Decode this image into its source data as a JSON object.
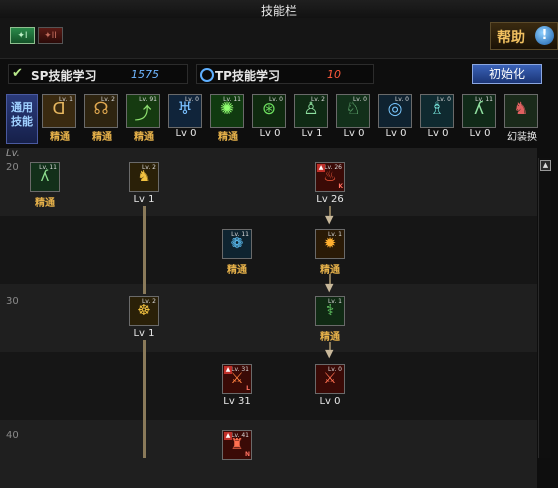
{
  "window": {
    "title": "技能栏"
  },
  "tabs": [
    {
      "label": "✦I",
      "active": true
    },
    {
      "label": "✦II",
      "active": false
    }
  ],
  "help": {
    "label": "帮助",
    "icon": "info-icon"
  },
  "points": {
    "sp": {
      "label": "SP技能学习",
      "value": "1575"
    },
    "tp": {
      "label": "TP技能学习",
      "value": "10"
    }
  },
  "init_button": {
    "label": "初始化"
  },
  "common": {
    "label_line1": "通用",
    "label_line2": "技能"
  },
  "common_skills": [
    {
      "lv": "Lv. 1",
      "caption": "精通",
      "caption_style": "gold",
      "icon": "dash-icon",
      "color": "#3a2a10",
      "glyph_color": "#e8b860",
      "glyph": "ᗡ"
    },
    {
      "lv": "Lv. 2",
      "caption": "精通",
      "caption_style": "gold",
      "icon": "pose-icon",
      "color": "#2e2410",
      "glyph_color": "#e0a850",
      "glyph": "☊"
    },
    {
      "lv": "Lv. 91",
      "caption": "精通",
      "caption_style": "gold",
      "icon": "leap-icon",
      "color": "#153a10",
      "glyph_color": "#8ee070",
      "glyph": "⤴"
    },
    {
      "lv": "Lv. 0",
      "caption": "Lv 0",
      "caption_style": "white",
      "icon": "wing-icon",
      "color": "#10243a",
      "glyph_color": "#7ac0ff",
      "glyph": "♅"
    },
    {
      "lv": "Lv. 11",
      "caption": "精通",
      "caption_style": "gold",
      "icon": "burst-icon",
      "color": "#103a10",
      "glyph_color": "#90ff70",
      "glyph": "✺"
    },
    {
      "lv": "Lv. 0",
      "caption": "Lv 0",
      "caption_style": "white",
      "icon": "aura-icon",
      "color": "#0f2a0f",
      "glyph_color": "#6ee060",
      "glyph": "⊛"
    },
    {
      "lv": "Lv. 2",
      "caption": "Lv 1",
      "caption_style": "white",
      "icon": "figure-icon",
      "color": "#0f2a14",
      "glyph_color": "#8ee0a0",
      "glyph": "♙"
    },
    {
      "lv": "Lv. 0",
      "caption": "Lv 0",
      "caption_style": "white",
      "icon": "warrior-icon",
      "color": "#12301a",
      "glyph_color": "#7ad08a",
      "glyph": "♘"
    },
    {
      "lv": "Lv. 0",
      "caption": "Lv 0",
      "caption_style": "white",
      "icon": "target-icon",
      "color": "#0f2230",
      "glyph_color": "#7ac8ff",
      "glyph": "◎"
    },
    {
      "lv": "Lv. 0",
      "caption": "Lv 0",
      "caption_style": "white",
      "icon": "body-icon",
      "color": "#0f2a30",
      "glyph_color": "#70d8d0",
      "glyph": "♗"
    },
    {
      "lv": "Lv. 11",
      "caption": "Lv 0",
      "caption_style": "white",
      "icon": "kick-icon",
      "color": "#102a18",
      "glyph_color": "#90e0a0",
      "glyph": "ʎ"
    },
    {
      "lv": "",
      "caption": "幻装换",
      "caption_style": "white",
      "icon": "swap-icon",
      "color": "#1a2a1a",
      "glyph_color": "#e06060",
      "glyph": "♞"
    }
  ],
  "tree": {
    "lv_header": "Lv.",
    "row_labels": [
      "20",
      "30",
      "40"
    ],
    "nodes": [
      {
        "lv": "Lv. 11",
        "caption": "精通",
        "caption_style": "gold",
        "icon": "slide-kick-icon",
        "color": "#12301a",
        "glyph_color": "#8ee090",
        "glyph": "ʎ",
        "locked": false
      },
      {
        "lv": "Lv. 2",
        "caption": "Lv 1",
        "caption_style": "white",
        "icon": "golden-slash-icon",
        "color": "#2a2008",
        "glyph_color": "#f0c040",
        "glyph": "♞",
        "locked": false
      },
      {
        "lv": "Lv. 26",
        "caption": "Lv 26",
        "caption_style": "white",
        "icon": "rage-icon",
        "color": "#3a0a06",
        "glyph_color": "#ff6040",
        "glyph": "♨",
        "locked": true,
        "key": "K"
      },
      {
        "lv": "Lv. 11",
        "caption": "精通",
        "caption_style": "gold",
        "icon": "water-swirl-icon",
        "color": "#0f2430",
        "glyph_color": "#60c8ff",
        "glyph": "❁",
        "locked": false
      },
      {
        "lv": "Lv. 1",
        "caption": "精通",
        "caption_style": "gold",
        "icon": "flame-burst-icon",
        "color": "#2a1a06",
        "glyph_color": "#ffb030",
        "glyph": "✹",
        "locked": false
      },
      {
        "lv": "Lv. 2",
        "caption": "Lv 1",
        "caption_style": "white",
        "icon": "golden-spin-icon",
        "color": "#2a2008",
        "glyph_color": "#f0c040",
        "glyph": "☸",
        "locked": false
      },
      {
        "lv": "Lv. 1",
        "caption": "精通",
        "caption_style": "gold",
        "icon": "green-kick-icon",
        "color": "#102a14",
        "glyph_color": "#70e070",
        "glyph": "⚕",
        "locked": false
      },
      {
        "lv": "Lv. 31",
        "caption": "Lv 31",
        "caption_style": "white",
        "icon": "red-strike-icon",
        "color": "#3a0a06",
        "glyph_color": "#ff8040",
        "glyph": "⚔",
        "locked": true,
        "key": "L"
      },
      {
        "lv": "Lv. 0",
        "caption": "Lv 0",
        "caption_style": "white",
        "icon": "red-sword-icon",
        "color": "#3a0a06",
        "glyph_color": "#ff7050",
        "glyph": "⚔",
        "locked": false
      },
      {
        "lv": "Lv. 41",
        "caption": "",
        "caption_style": "white",
        "icon": "red-lock-icon",
        "color": "#3a0a06",
        "glyph_color": "#ff7050",
        "glyph": "♜",
        "locked": true,
        "key": "N"
      }
    ]
  },
  "colors": {
    "gold": "#e7b24a",
    "accent": "#3a62b8"
  }
}
